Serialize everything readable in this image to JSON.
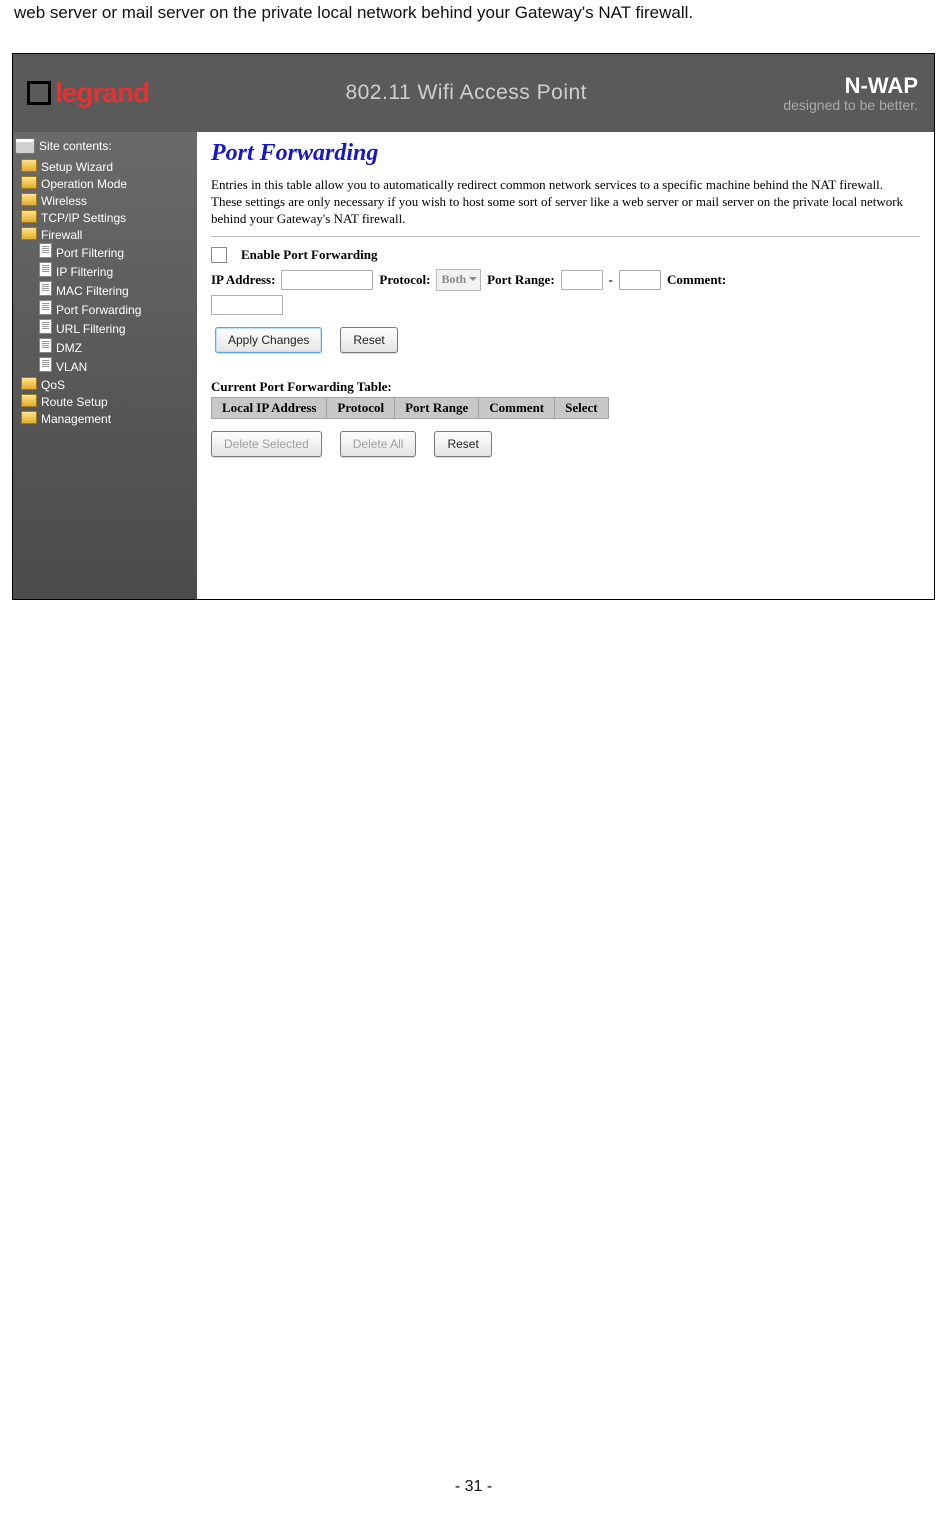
{
  "intro_fragment": "web server or mail server on the private local network behind your Gateway's NAT firewall.",
  "header": {
    "logo_text": "legrand",
    "mid": "802.11 Wifi Access Point",
    "brand": "N-WAP",
    "tagline": "designed to be better."
  },
  "sidebar": {
    "title": "Site contents:",
    "items": [
      {
        "type": "folder",
        "label": "Setup Wizard"
      },
      {
        "type": "folder",
        "label": "Operation Mode"
      },
      {
        "type": "folder",
        "label": "Wireless"
      },
      {
        "type": "folder",
        "label": "TCP/IP Settings"
      },
      {
        "type": "folder",
        "label": "Firewall",
        "active": true,
        "children": [
          {
            "type": "file",
            "label": "Port Filtering"
          },
          {
            "type": "file",
            "label": "IP Filtering"
          },
          {
            "type": "file",
            "label": "MAC Filtering"
          },
          {
            "type": "file",
            "label": "Port Forwarding"
          },
          {
            "type": "file",
            "label": "URL Filtering"
          },
          {
            "type": "file",
            "label": "DMZ"
          },
          {
            "type": "file",
            "label": "VLAN"
          }
        ]
      },
      {
        "type": "folder",
        "label": "QoS"
      },
      {
        "type": "folder",
        "label": "Route Setup"
      },
      {
        "type": "folder",
        "label": "Management"
      }
    ]
  },
  "main": {
    "heading": "Port Forwarding",
    "description": "Entries in this table allow you to automatically redirect common network services to a specific machine behind the NAT firewall. These settings are only necessary if you wish to host some sort of server like a web server or mail server on the private local network behind your Gateway's NAT firewall.",
    "enable_label": "Enable Port Forwarding",
    "labels": {
      "ip": "IP Address:",
      "protocol": "Protocol:",
      "port_range": "Port Range:",
      "range_sep": "-",
      "comment": "Comment:"
    },
    "protocol_value": "Both",
    "buttons": {
      "apply": "Apply Changes",
      "reset": "Reset",
      "delete_selected": "Delete Selected",
      "delete_all": "Delete All",
      "reset2": "Reset"
    },
    "table_title": "Current Port Forwarding Table:",
    "table_headers": [
      "Local IP Address",
      "Protocol",
      "Port Range",
      "Comment",
      "Select"
    ]
  },
  "page_number": "- 31 -"
}
